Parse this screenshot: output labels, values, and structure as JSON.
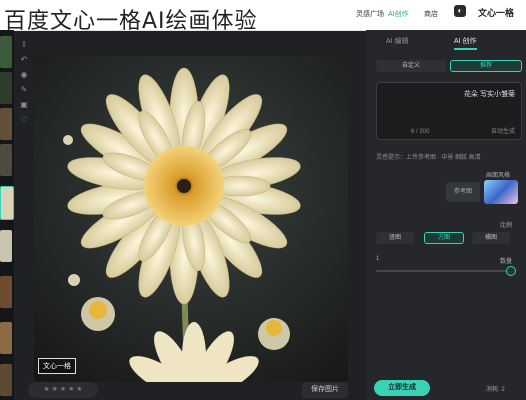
{
  "caption_overlay": "百度文心一格AI绘画体验",
  "header": {
    "nav": [
      "灵感广场",
      "AI创作",
      "商店"
    ],
    "brand": "文心一格"
  },
  "tools": [
    "上传",
    "撤销",
    "眼睛",
    "编辑",
    "删除",
    "收藏"
  ],
  "canvas": {
    "watermark": "文心一格",
    "rating_text": "★ ★ ★ ★ ★",
    "save_button": "保存图片"
  },
  "panel": {
    "tabs": [
      "AI 创作",
      "AI 编辑"
    ],
    "modes": [
      "推荐",
      "自定义"
    ],
    "prompt_text": "花朵 写实小雏菊",
    "prompt_counter": "6 / 200",
    "prompt_ai_label": "自动生成",
    "hint": "灵感提示：上传参考图 · 中景 细腻 高清",
    "labels": {
      "reference": "参考图",
      "style": "画面风格",
      "size": "比例",
      "count": "数量"
    },
    "ratios": [
      "竖图",
      "方图",
      "横图"
    ],
    "count_value": "1",
    "generate_button": "立即生成",
    "credit_text": "消耗: 2"
  },
  "colors": {
    "accent": "#3ad1b5",
    "panel_bg": "#25272a",
    "page_bg": "#1f2124"
  }
}
